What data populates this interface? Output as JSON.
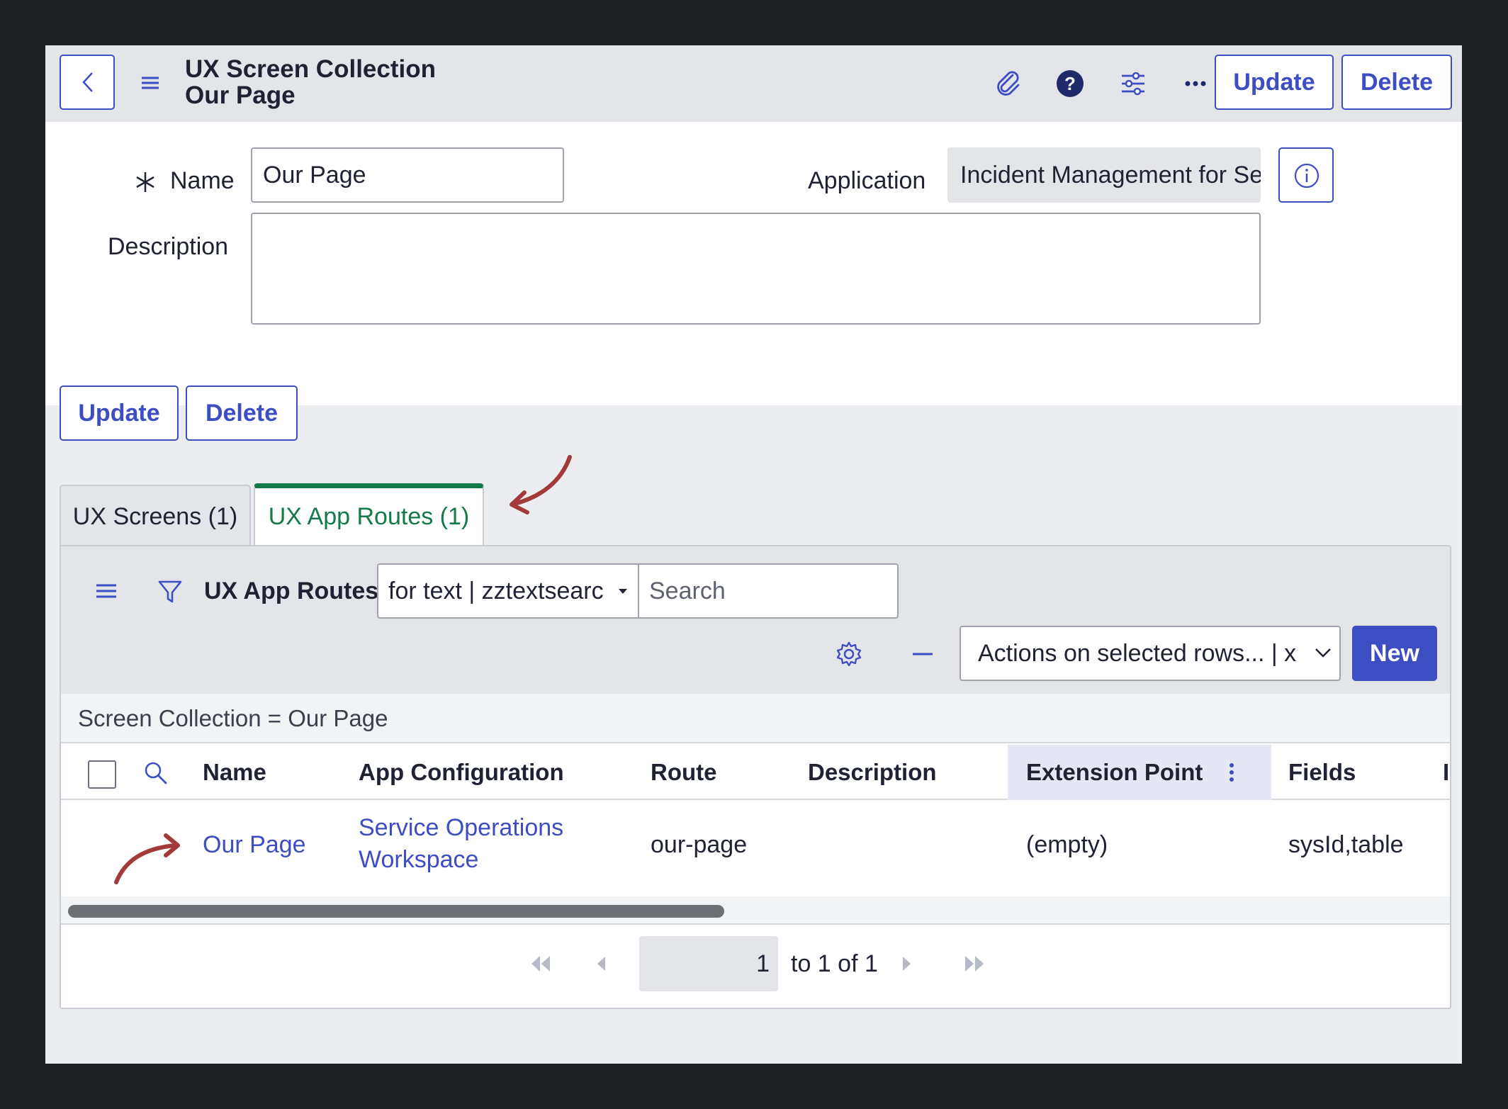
{
  "header": {
    "title_line1": "UX Screen Collection",
    "title_line2": "Our Page",
    "update_label": "Update",
    "delete_label": "Delete",
    "icons": [
      "back-icon",
      "hamburger-icon",
      "paperclip-icon",
      "help-icon",
      "settings-sliders-icon",
      "more-icon"
    ]
  },
  "form": {
    "name_label": "Name",
    "name_value": "Our Page",
    "application_label": "Application",
    "application_value": "Incident Management for Se",
    "description_label": "Description",
    "description_value": ""
  },
  "form_actions": {
    "update_label": "Update",
    "delete_label": "Delete"
  },
  "tabs": [
    {
      "label": "UX Screens (1)",
      "active": false
    },
    {
      "label": "UX App Routes (1)",
      "active": true
    }
  ],
  "list": {
    "title": "UX App Routes",
    "filter_option": "for text | zztextsearc",
    "search_placeholder": "Search",
    "actions_placeholder": "Actions on selected rows... | x",
    "new_label": "New",
    "breadcrumb": "Screen Collection = Our Page",
    "columns": [
      "Name",
      "App Configuration",
      "Route",
      "Description",
      "Extension Point",
      "Fields",
      "I"
    ],
    "rows": [
      {
        "name": "Our Page",
        "app_configuration_line1": "Service Operations",
        "app_configuration_line2": "Workspace",
        "route": "our-page",
        "description": "",
        "extension_point": "(empty)",
        "fields": "sysId,table"
      }
    ],
    "pager": {
      "current": "1",
      "text": "to 1 of 1"
    }
  },
  "colors": {
    "accent": "#3d4dc2",
    "active_tab": "#137a49",
    "annotation_arrow": "#a33a3a"
  }
}
